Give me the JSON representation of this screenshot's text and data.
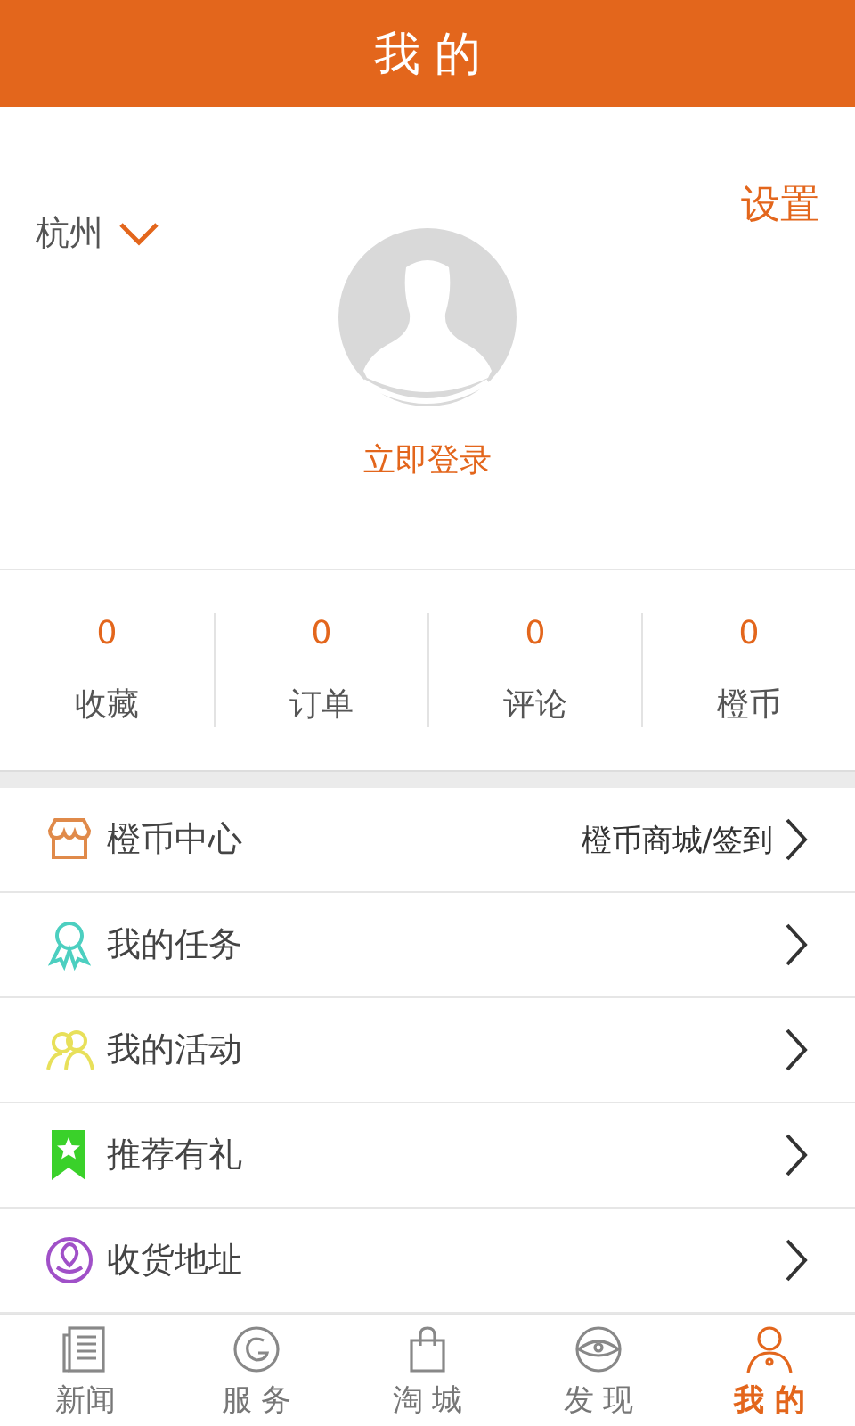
{
  "header": {
    "title": "我 的"
  },
  "profile": {
    "city": "杭州",
    "settings": "设置",
    "login": "立即登录"
  },
  "stats": [
    {
      "value": "0",
      "label": "收藏"
    },
    {
      "value": "0",
      "label": "订单"
    },
    {
      "value": "0",
      "label": "评论"
    },
    {
      "value": "0",
      "label": "橙币"
    }
  ],
  "menu": [
    {
      "kind": "shop",
      "label": "橙币中心",
      "detail": "橙币商城/签到"
    },
    {
      "kind": "medal",
      "label": "我的任务"
    },
    {
      "kind": "people",
      "label": "我的活动"
    },
    {
      "kind": "bookmark",
      "label": "推荐有礼"
    },
    {
      "kind": "address",
      "label": "收货地址"
    }
  ],
  "tabs": [
    {
      "kind": "news",
      "label": "新闻",
      "selected": false
    },
    {
      "kind": "service",
      "label": "服 务",
      "selected": false
    },
    {
      "kind": "bag",
      "label": "淘 城",
      "selected": false
    },
    {
      "kind": "eye",
      "label": "发 现",
      "selected": false
    },
    {
      "kind": "person",
      "label": "我 的",
      "selected": true
    }
  ]
}
